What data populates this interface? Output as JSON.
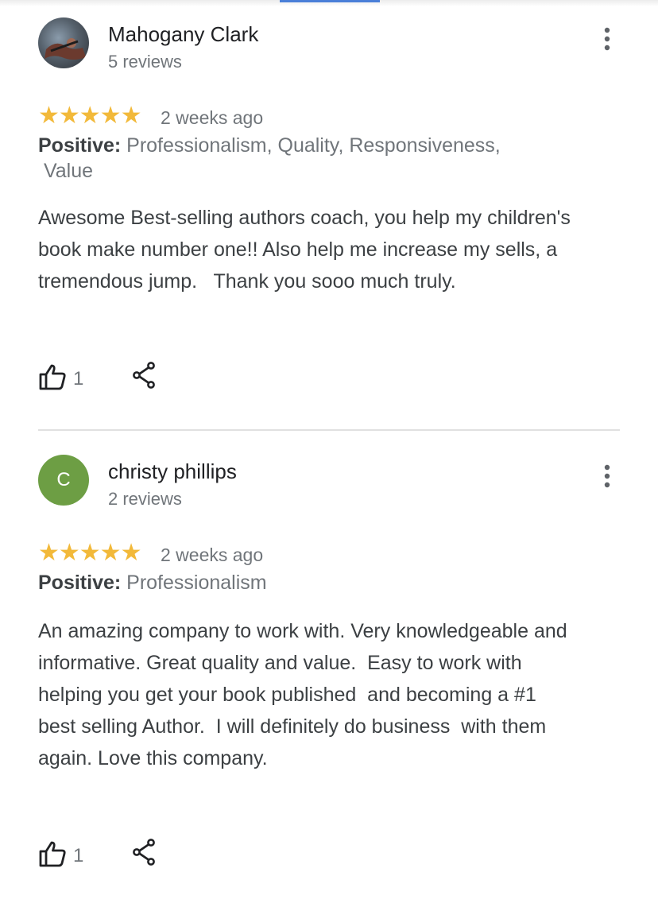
{
  "reviews": [
    {
      "name": "Mahogany Clark",
      "review_count": "5 reviews",
      "avatar": {
        "type": "photo",
        "icon": "profile-photo"
      },
      "stars": "★★★★★",
      "rating": 5,
      "date": "2 weeks ago",
      "positive_label": "Positive:",
      "positive_values": "Professionalism, Quality, Responsiveness,\n Value",
      "text": "Awesome Best-selling authors coach, you help my children's book make number one!! Also help me increase my sells, a tremendous jump.   Thank you sooo much truly.",
      "likes": "1"
    },
    {
      "name": "christy phillips",
      "review_count": "2 reviews",
      "avatar": {
        "type": "letter",
        "letter": "C",
        "color": "#6d9e44"
      },
      "stars": "★★★★★",
      "rating": 5,
      "date": "2 weeks ago",
      "positive_label": "Positive:",
      "positive_values": "Professionalism",
      "text": "An amazing company to work with. Very knowledgeable and informative. Great quality and value.  Easy to work with helping you get your book published  and becoming a #1 best selling Author.  I will definitely do business  with them again. Love this company.",
      "likes": "1"
    }
  ],
  "colors": {
    "star": "#f2b93a",
    "text": "#3c4043",
    "secondary": "#70757a",
    "divider": "#e0e0e0"
  },
  "icons": [
    "thumb-up-icon",
    "share-icon",
    "more-vert-icon"
  ]
}
